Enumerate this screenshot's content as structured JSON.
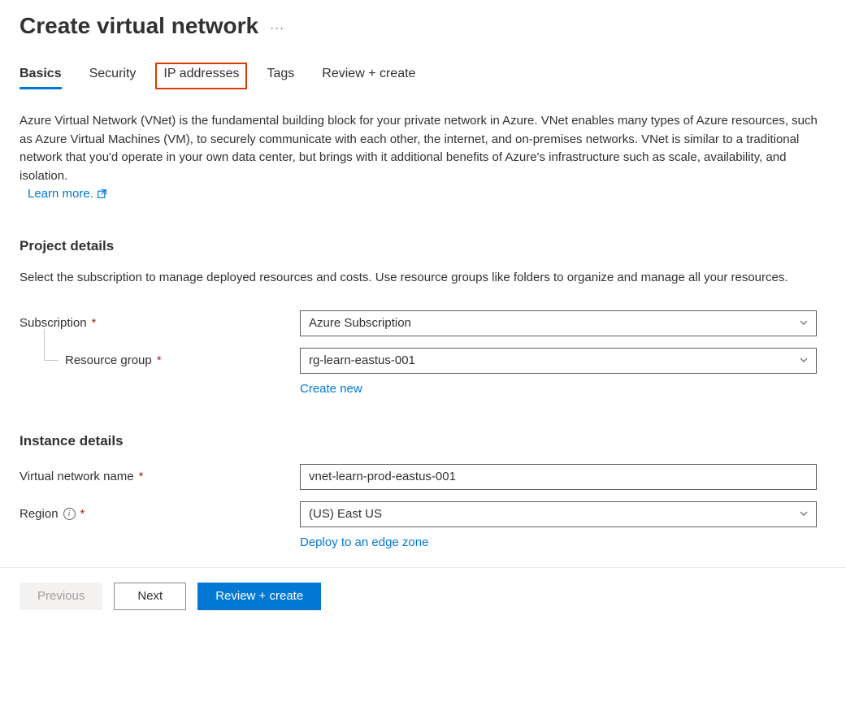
{
  "header": {
    "title": "Create virtual network"
  },
  "tabs": {
    "basics": "Basics",
    "security": "Security",
    "ip_addresses": "IP addresses",
    "tags": "Tags",
    "review": "Review + create"
  },
  "intro": {
    "description": "Azure Virtual Network (VNet) is the fundamental building block for your private network in Azure. VNet enables many types of Azure resources, such as Azure Virtual Machines (VM), to securely communicate with each other, the internet, and on-premises networks. VNet is similar to a traditional network that you'd operate in your own data center, but brings with it additional benefits of Azure's infrastructure such as scale, availability, and isolation.",
    "learn_more": "Learn more."
  },
  "project": {
    "heading": "Project details",
    "description": "Select the subscription to manage deployed resources and costs. Use resource groups like folders to organize and manage all your resources.",
    "subscription_label": "Subscription",
    "subscription_value": "Azure Subscription",
    "resource_group_label": "Resource group",
    "resource_group_value": "rg-learn-eastus-001",
    "create_new": "Create new"
  },
  "instance": {
    "heading": "Instance details",
    "vnet_name_label": "Virtual network name",
    "vnet_name_value": "vnet-learn-prod-eastus-001",
    "region_label": "Region",
    "region_value": "(US) East US",
    "deploy_edge": "Deploy to an edge zone"
  },
  "footer": {
    "previous": "Previous",
    "next": "Next",
    "review": "Review + create"
  }
}
